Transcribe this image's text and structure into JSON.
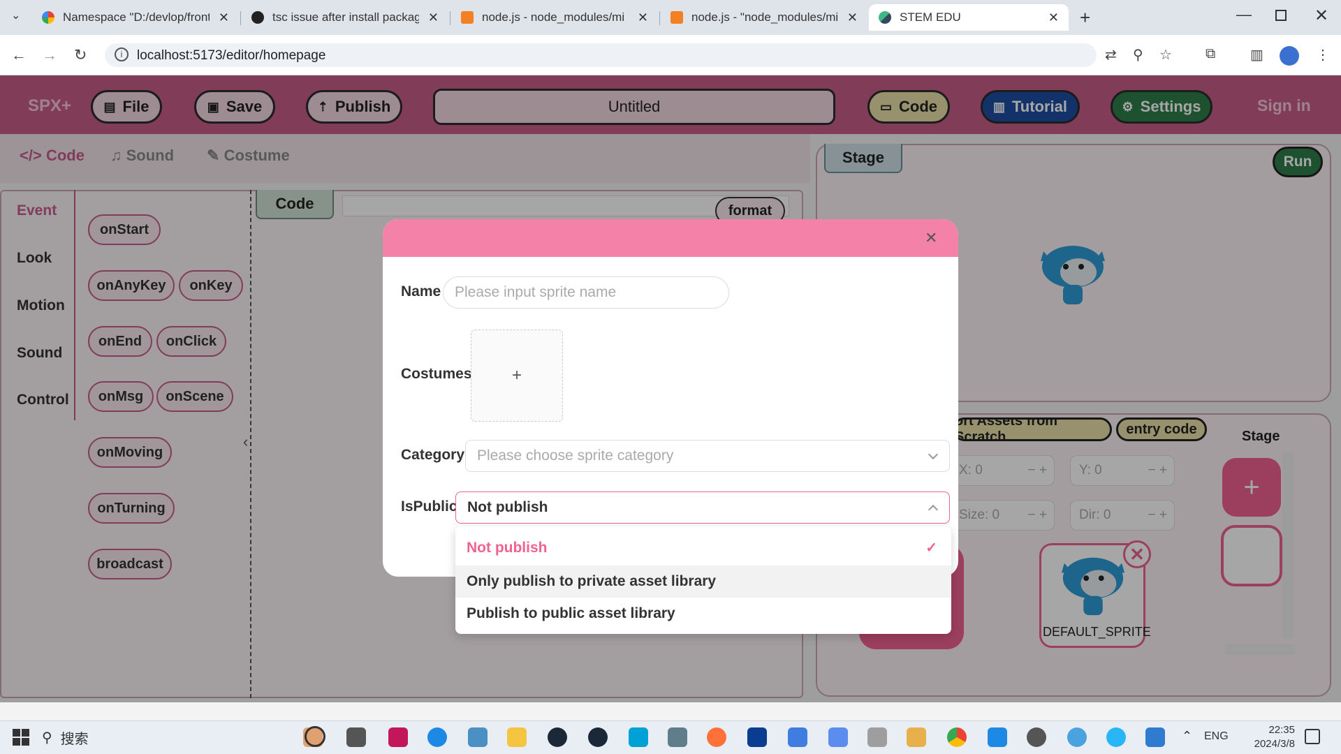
{
  "browser": {
    "tabs": [
      {
        "title": "Namespace \"D:/devlop/front",
        "favicon": "google-icon"
      },
      {
        "title": "tsc issue after install package",
        "favicon": "github-icon"
      },
      {
        "title": "node.js - node_modules/mi",
        "favicon": "stackoverflow-icon"
      },
      {
        "title": "node.js - \"node_modules/mi",
        "favicon": "stackoverflow-icon"
      },
      {
        "title": "STEM EDU",
        "favicon": "vue-icon"
      }
    ],
    "url": "localhost:5173/editor/homepage"
  },
  "header": {
    "brand": "SPX+",
    "file": "File",
    "save": "Save",
    "publish": "Publish",
    "project_title": "Untitled",
    "code": "Code",
    "tutorial": "Tutorial",
    "settings": "Settings",
    "signin": "Sign in"
  },
  "subtabs": {
    "code": "Code",
    "sound": "Sound",
    "costume": "Costume"
  },
  "categories": [
    "Event",
    "Look",
    "Motion",
    "Sound",
    "Control"
  ],
  "blocks": [
    "onStart",
    "onAnyKey",
    "onKey",
    "onEnd",
    "onClick",
    "onMsg",
    "onScene",
    "onMoving",
    "onTurning",
    "broadcast"
  ],
  "code_panel": {
    "tab": "Code",
    "format": "format"
  },
  "stage": {
    "label": "Stage",
    "run": "Run"
  },
  "sprite_panel": {
    "import": "ort Assets from Scratch",
    "entry": "entry code",
    "stage_label": "Stage",
    "x": "X: 0",
    "y": "Y: 0",
    "size": "Size: 0",
    "dir": "Dir: 0",
    "sprite_name": "DEFAULT_SPRITE"
  },
  "modal": {
    "name_label": "Name",
    "name_placeholder": "Please input sprite name",
    "costumes_label": "Costumes:",
    "category_label": "Category:",
    "category_placeholder": "Please choose sprite category",
    "ispublic_label": "IsPublic",
    "ispublic_value": "Not publish",
    "options": [
      "Not publish",
      "Only publish to private asset library",
      "Publish to public asset library"
    ],
    "selected_option": 0
  },
  "taskbar": {
    "search": "搜索",
    "lang": "ENG",
    "time": "22:35",
    "date": "2024/3/8"
  },
  "colors": {
    "primary": "#c75c87",
    "modal_header": "#f482a8",
    "selected_option": "#f06292",
    "run": "#2f7d4b"
  }
}
